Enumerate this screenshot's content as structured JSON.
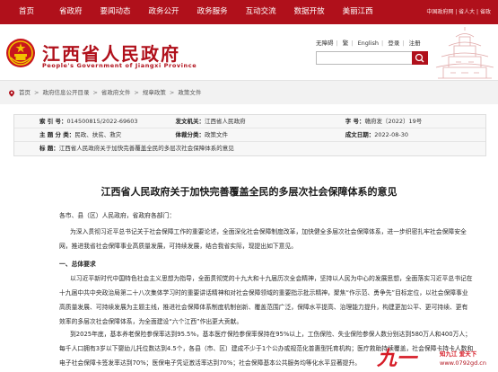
{
  "nav": {
    "items": [
      "首页",
      "省政府",
      "要闻动态",
      "政务公开",
      "政务服务",
      "互动交流",
      "数据开放",
      "美丽江西"
    ],
    "right": "中国政府网 | 省人大 | 省政"
  },
  "header": {
    "title": "江西省人民政府",
    "subtitle": "People's Government of Jiangxi Province",
    "links": [
      "无障碍",
      "繁",
      "English",
      "登录",
      "注册"
    ],
    "search_placeholder": ""
  },
  "breadcrumb": [
    "首页",
    "政府信息公开目录",
    "省政府文件",
    "规章政策",
    "政策文件"
  ],
  "info": {
    "row1": {
      "l1": "索  引  号：",
      "v1": "014500815/2022-69603",
      "l2": "发文机关：",
      "v2": "江西省人民政府",
      "l3": "字  号：",
      "v3": "赣府发〔2022〕19号"
    },
    "row2": {
      "l1": "主  题  分  类：",
      "v1": "民政、扶贫、救灾",
      "l2": "体裁分类：",
      "v2": "政策文件",
      "l3": "成文日期：",
      "v3": "2022-08-30"
    },
    "row3": {
      "l1": "标      题：",
      "v1": "江西省人民政府关于加快完善覆盖全民的多层次社会保障体系的意见"
    }
  },
  "article": {
    "title": "江西省人民政府关于加快完善覆盖全民的多层次社会保障体系的意见",
    "addressee": "各市、县（区）人民政府，省政府各部门：",
    "intro": "为深入贯彻习近平总书记关于社会保障工作的重要论述，全面深化社会保障制度改革，加快健全多层次社会保障体系，进一步织密扎牢社会保障安全网，推进我省社会保障事业高质量发展，可持续发展，结合我省实际，现提出如下意见。",
    "section1": "一、总体要求",
    "body1": "以习近平新时代中国特色社会主义思想为指导，全面贯彻党的十九大和十九届历次全会精神，坚持以人民为中心的发展思想，全面落实习近平总书记在十九届中共中央政治局第二十八次集体学习时的重要讲话精神和对社会保障领域的重要指示批示精神，聚焦“作示范、勇争先”目标定位，以社会保障事业高质量发展、可持续发展为主题主线，推进社会保障体系制度机制创新、覆盖范围广泛，保障水平提高、治理能力提升，构建更加公平、更可持续、更有效率的多层次社会保障体系，为全面建设“六个江西”作出更大贡献。",
    "body2": "到2025年底，基本养老保险参保率达到95.5%，基本医疗保险参保率保持在95%以上，工伤保险、失业保险参保人数分别达到580万人和400万人；每千人口拥有3岁以下婴幼儿托位数达到4.5个，各县（市、区）建成不少于1个公办或规范化普惠型托育机构；医疗救助持续覆盖，社会保障卡持卡人数和电子社会保障卡签发率达到70%；医保电子凭证激活率达到70%；社会保障基本公共服务均等化水平显著提升。"
  },
  "watermark": {
    "logo": "九一",
    "slogan": "知九江  爱天下",
    "url": "www.0792gd.cn"
  }
}
